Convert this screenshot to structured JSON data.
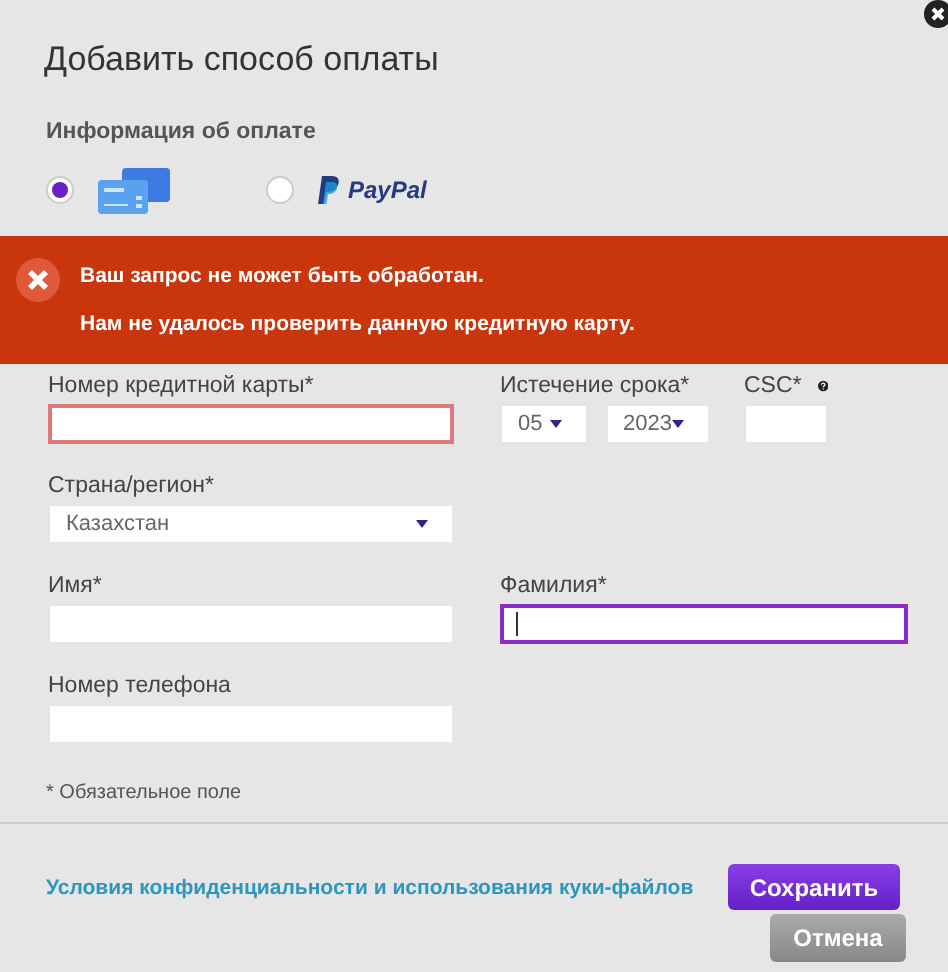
{
  "dialog": {
    "title": "Добавить способ оплаты"
  },
  "payment": {
    "heading": "Информация об оплате",
    "methods": [
      {
        "kind": "card",
        "selected": true
      },
      {
        "kind": "paypal",
        "selected": false,
        "label": "PayPal"
      }
    ]
  },
  "error": {
    "lines": [
      "Ваш запрос не может быть обработан.",
      "Нам не удалось проверить данную кредитную карту."
    ]
  },
  "rows": [
    {
      "fields": [
        {
          "kind": "text",
          "label": "Номер кредитной карты*",
          "invalid": true,
          "focused": false,
          "help": false
        },
        {
          "kind": "date",
          "label": "Истечение срока*",
          "selects": [
            "05",
            "2023"
          ],
          "help": false
        },
        {
          "kind": "text",
          "label": "CSC*",
          "invalid": false,
          "focused": false,
          "help": true
        }
      ]
    },
    {
      "fields": [
        {
          "kind": "select",
          "label": "Страна/регион*",
          "value": "Казахстан",
          "help": false
        }
      ]
    },
    {
      "fields": [
        {
          "kind": "text",
          "label": "Имя*",
          "invalid": false,
          "focused": false,
          "help": false
        },
        {
          "kind": "text",
          "label": "Фамилия*",
          "invalid": false,
          "focused": true,
          "help": false
        }
      ]
    },
    {
      "fields": [
        {
          "kind": "text",
          "label": "Номер телефона",
          "invalid": false,
          "focused": false,
          "help": false
        }
      ]
    }
  ],
  "required_note": "* Обязательное поле",
  "footer": {
    "link": "Условия конфиденциальности и использования куки-файлов",
    "buttons": [
      {
        "kind": "primary",
        "label": "Сохранить"
      },
      {
        "kind": "secondary",
        "label": "Отмена"
      }
    ]
  }
}
